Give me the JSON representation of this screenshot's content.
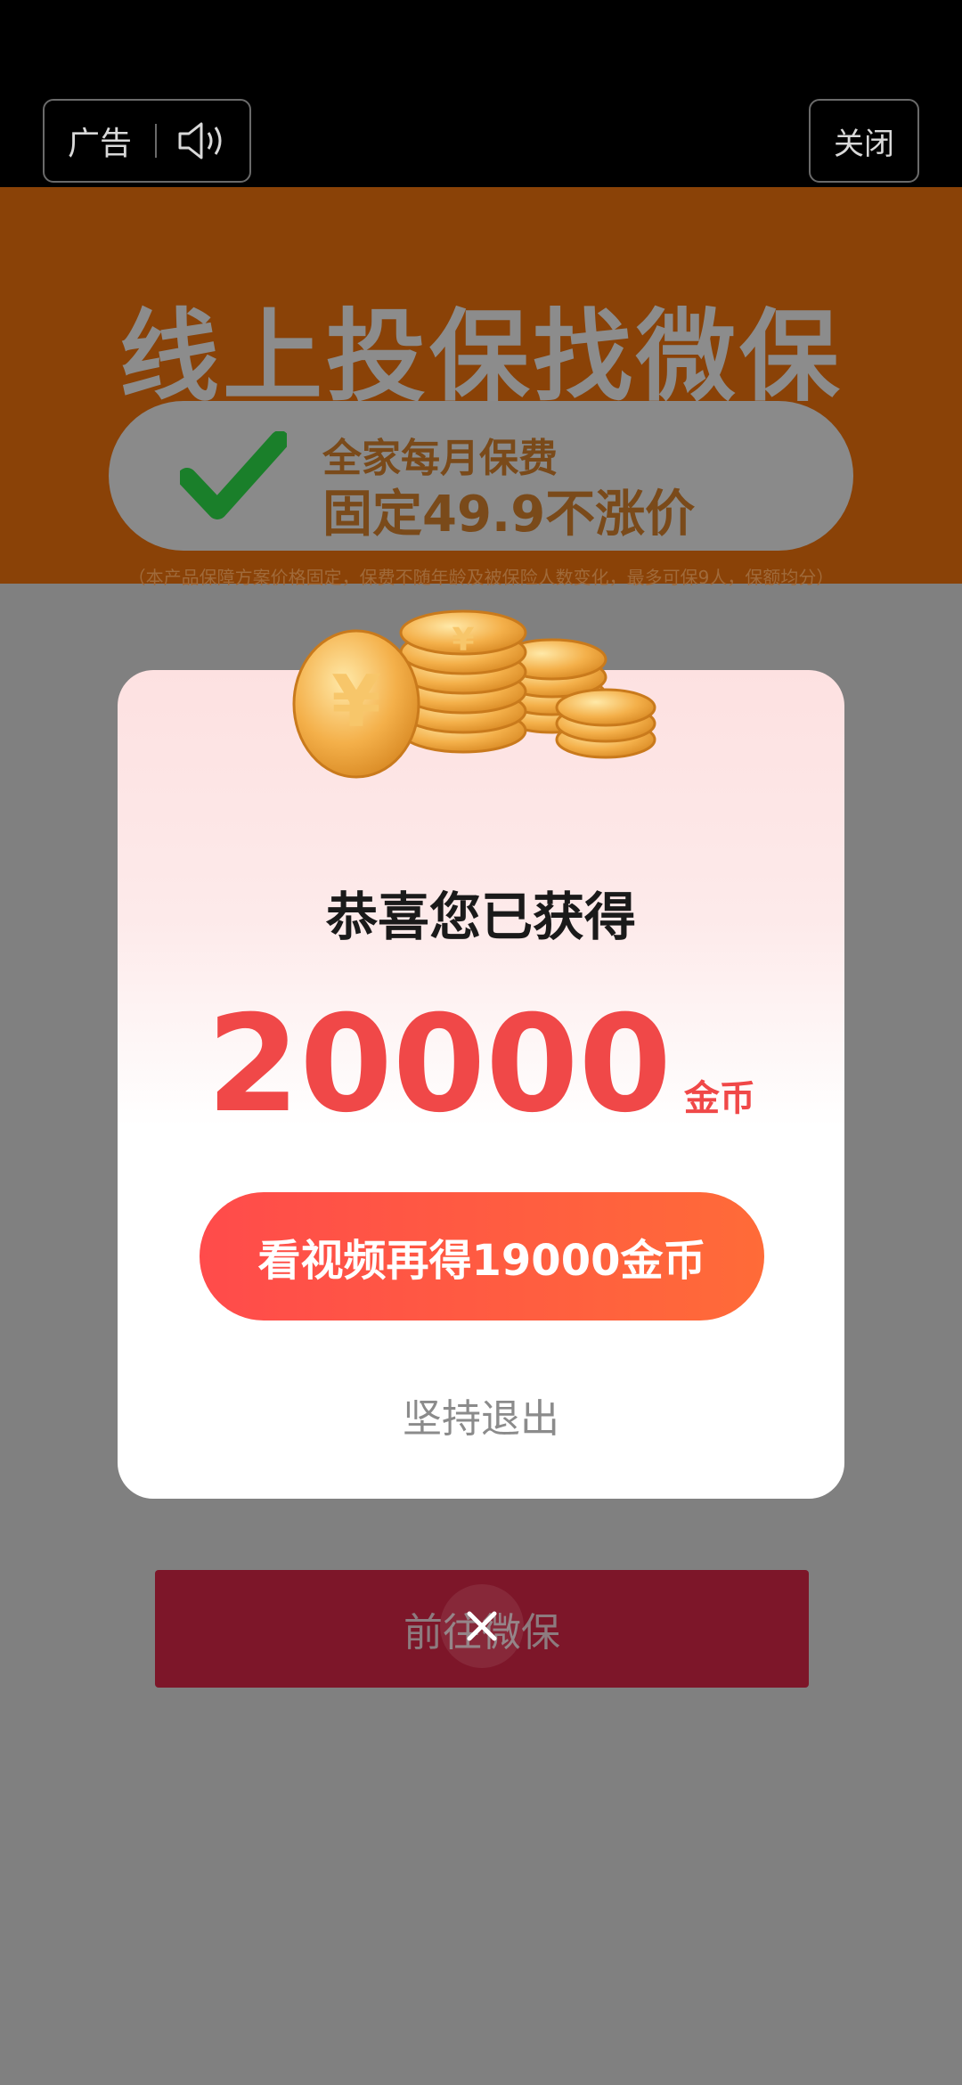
{
  "top_bar": {
    "ad_label": "广告",
    "close_label": "关闭"
  },
  "banner": {
    "headline": "线上投保找微保",
    "pill_line1": "全家每月保费",
    "pill_line2": "固定49.9不涨价",
    "footnote": "（本产品保障方案价格固定，保费不随年龄及被保险人数变化，最多可保9人，保额均分）",
    "colors": {
      "banner_bg": "#8a4207",
      "check": "#1a7f2a"
    }
  },
  "modal": {
    "title": "恭喜您已获得",
    "amount": "20000",
    "unit": "金币",
    "cta_label": "看视频再得19000金币",
    "quit_label": "坚持退出",
    "colors": {
      "amount": "#f04848",
      "cta_start": "#ff4b4b",
      "cta_end": "#ff6b38"
    }
  },
  "bottom": {
    "button_label": "前往微保"
  }
}
